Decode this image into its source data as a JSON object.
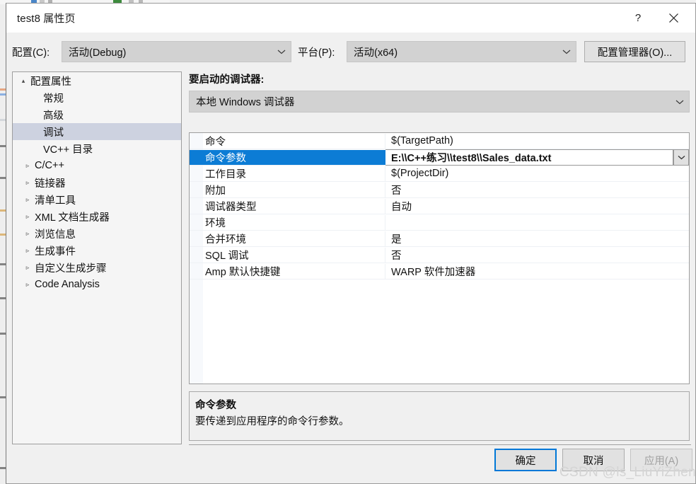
{
  "window": {
    "title": "test8 属性页",
    "help_label": "?",
    "close_label": "✕"
  },
  "config_bar": {
    "config_label": "配置(C):",
    "config_value": "活动(Debug)",
    "platform_label": "平台(P):",
    "platform_value": "活动(x64)",
    "config_manager_button": "配置管理器(O)..."
  },
  "tree": {
    "items": [
      {
        "label": "配置属性",
        "level": 0,
        "twisty": "▴",
        "expanded": true,
        "selected": false
      },
      {
        "label": "常规",
        "level": 1,
        "twisty": "",
        "expanded": false,
        "selected": false
      },
      {
        "label": "高级",
        "level": 1,
        "twisty": "",
        "expanded": false,
        "selected": false
      },
      {
        "label": "调试",
        "level": 1,
        "twisty": "",
        "expanded": false,
        "selected": true
      },
      {
        "label": "VC++ 目录",
        "level": 1,
        "twisty": "",
        "expanded": false,
        "selected": false
      },
      {
        "label": "C/C++",
        "level": 1,
        "twisty": "▹",
        "expanded": false,
        "selected": false
      },
      {
        "label": "链接器",
        "level": 1,
        "twisty": "▹",
        "expanded": false,
        "selected": false
      },
      {
        "label": "清单工具",
        "level": 1,
        "twisty": "▹",
        "expanded": false,
        "selected": false
      },
      {
        "label": "XML 文档生成器",
        "level": 1,
        "twisty": "▹",
        "expanded": false,
        "selected": false
      },
      {
        "label": "浏览信息",
        "level": 1,
        "twisty": "▹",
        "expanded": false,
        "selected": false
      },
      {
        "label": "生成事件",
        "level": 1,
        "twisty": "▹",
        "expanded": false,
        "selected": false
      },
      {
        "label": "自定义生成步骤",
        "level": 1,
        "twisty": "▹",
        "expanded": false,
        "selected": false
      },
      {
        "label": "Code Analysis",
        "level": 1,
        "twisty": "▹",
        "expanded": false,
        "selected": false
      }
    ]
  },
  "debugger_select": {
    "label": "要启动的调试器:",
    "value": "本地 Windows 调试器",
    "arrow": "⌄"
  },
  "property_grid": {
    "rows": [
      {
        "name": "命令",
        "value": "$(TargetPath)",
        "selected": false
      },
      {
        "name": "命令参数",
        "value": "E:\\\\C++练习\\\\test8\\\\Sales_data.txt",
        "selected": true
      },
      {
        "name": "工作目录",
        "value": "$(ProjectDir)",
        "selected": false
      },
      {
        "name": "附加",
        "value": "否",
        "selected": false
      },
      {
        "name": "调试器类型",
        "value": "自动",
        "selected": false
      },
      {
        "name": "环境",
        "value": "",
        "selected": false
      },
      {
        "name": "合并环境",
        "value": "是",
        "selected": false
      },
      {
        "name": "SQL 调试",
        "value": "否",
        "selected": false
      },
      {
        "name": "Amp 默认快捷键",
        "value": "WARP 软件加速器",
        "selected": false
      }
    ],
    "row_dropdown_arrow": "⌄"
  },
  "description": {
    "title": "命令参数",
    "body": "要传递到应用程序的命令行参数。"
  },
  "footer": {
    "ok_label": "确定",
    "cancel_label": "取消",
    "apply_label": "应用(A)"
  },
  "watermark": {
    "text": "CSDN @ls_LiuYiZheng"
  },
  "colors": {
    "accent_blue": "#0c7cd5",
    "focus_blue": "#0078d7",
    "tree_selection": "#cdd2e0",
    "dialog_bg": "#f0f0f0",
    "combo_bg": "#d2d2d2"
  }
}
